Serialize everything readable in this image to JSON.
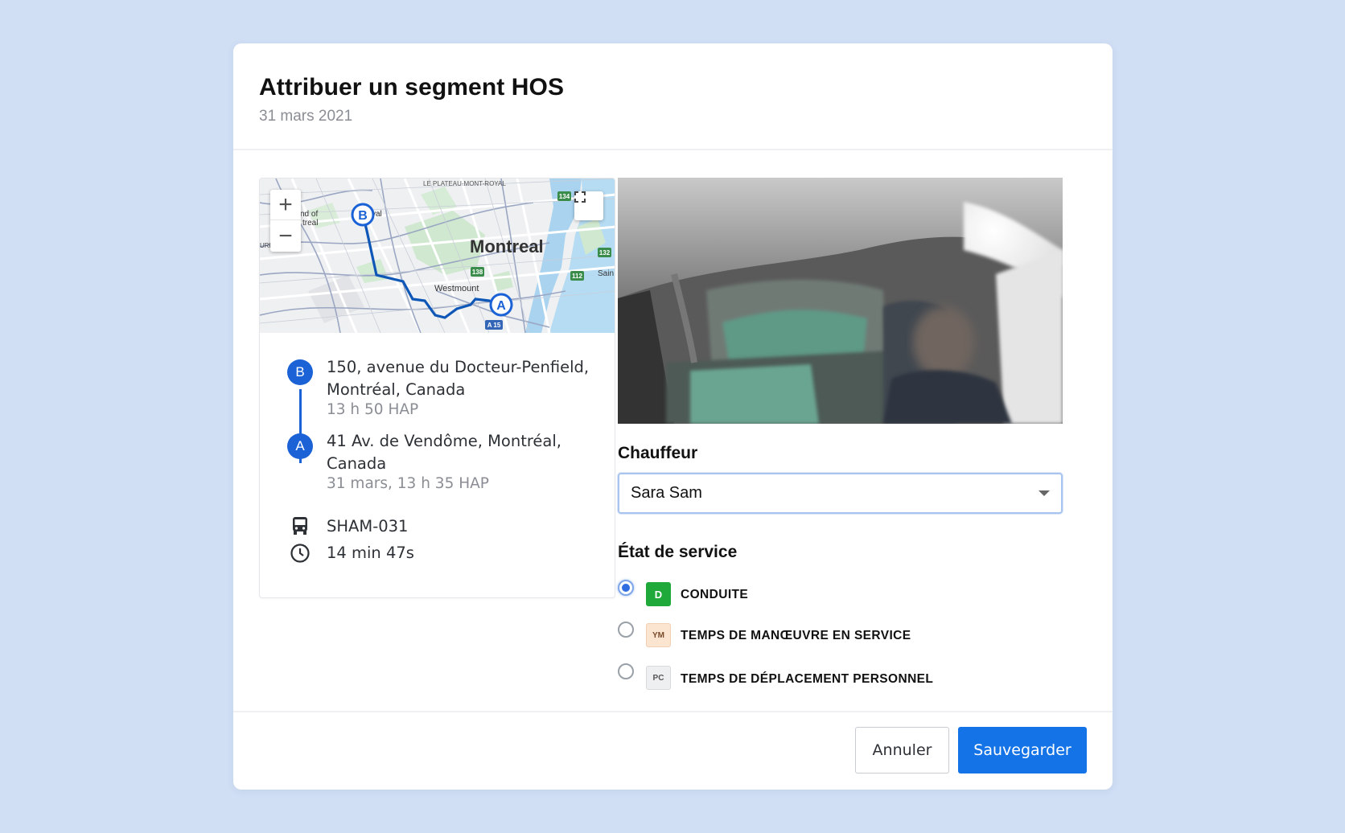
{
  "modal": {
    "title": "Attribuer un segment HOS",
    "date": "31 mars 2021"
  },
  "map": {
    "labels": {
      "neighborhood": "LE PLATEAU-MONT-ROYAL",
      "city": "Montreal",
      "westmount": "Westmount",
      "left_label_1": "nd of",
      "left_label_2": "treal",
      "left_label_3": "URE",
      "royal": "yal",
      "saint": "Sain",
      "hwy_134": "134",
      "hwy_132": "132",
      "hwy_138": "138",
      "hwy_112": "112",
      "hwy_a15": "A 15"
    },
    "marker_a": "A",
    "marker_b": "B",
    "zoom_in": "+",
    "zoom_out": "−"
  },
  "route": {
    "end": {
      "letter": "B",
      "address": "150, avenue du Docteur-Penfield, Montréal, Canada",
      "time": "13 h 50 HAP"
    },
    "start": {
      "letter": "A",
      "address": "41 Av. de Vendôme, Montréal, Canada",
      "time": "31 mars, 13 h 35 HAP"
    },
    "vehicle": "SHAM-031",
    "duration": "14 min 47s"
  },
  "driver": {
    "label": "Chauffeur",
    "selected": "Sara Sam"
  },
  "duty_status": {
    "label": "État de service",
    "options": [
      {
        "code": "D",
        "label": "CONDUITE",
        "checked": true
      },
      {
        "code": "YM",
        "label": "TEMPS DE MANŒUVRE EN SERVICE",
        "checked": false
      },
      {
        "code": "PC",
        "label": "TEMPS DE DÉPLACEMENT PERSONNEL",
        "checked": false
      }
    ]
  },
  "footer": {
    "cancel": "Annuler",
    "save": "Sauvegarder"
  },
  "colors": {
    "background": "#d1dff5",
    "primary": "#1473e6",
    "route": "#1a62d6",
    "driving_badge": "#1fa93b"
  }
}
